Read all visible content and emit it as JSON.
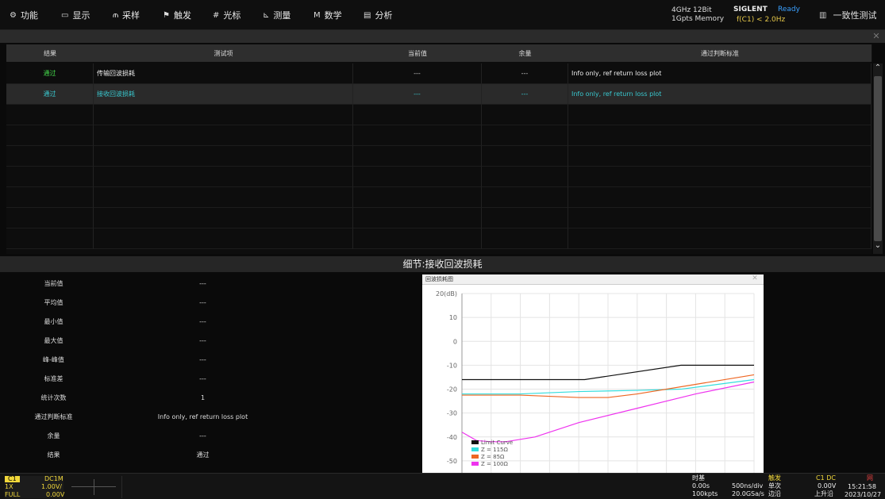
{
  "menu": {
    "items": [
      {
        "icon": "⚙",
        "label": "功能"
      },
      {
        "icon": "▭",
        "label": "显示"
      },
      {
        "icon": "⫙",
        "label": "采样"
      },
      {
        "icon": "⚑",
        "label": "触发"
      },
      {
        "icon": "#",
        "label": "光标"
      },
      {
        "icon": "⊾",
        "label": "测量"
      },
      {
        "icon": "M",
        "label": "数学"
      },
      {
        "icon": "▤",
        "label": "分析"
      }
    ],
    "spec_line1": "4GHz 12Bit",
    "spec_line2": "1Gpts Memory",
    "brand": "SIGLENT",
    "run_status": "Ready",
    "freq": "f(C1) < 2.0Hz",
    "conformance_icon": "▥",
    "conformance": "一致性测试"
  },
  "table": {
    "headers": [
      "结果",
      "测试项",
      "当前值",
      "余量",
      "通过判断标准"
    ],
    "rows": [
      {
        "result": "通过",
        "item": "传输回波损耗",
        "current": "---",
        "margin": "---",
        "criteria": "Info only, ref return loss plot"
      },
      {
        "result": "通过",
        "item": "接收回波损耗",
        "current": "---",
        "margin": "---",
        "criteria": "Info only, ref return loss plot"
      }
    ],
    "empty_rows": 7
  },
  "detail": {
    "title": "细节:接收回波损耗",
    "rows": [
      {
        "label": "当前值",
        "value": "---"
      },
      {
        "label": "平均值",
        "value": "---"
      },
      {
        "label": "最小值",
        "value": "---"
      },
      {
        "label": "最大值",
        "value": "---"
      },
      {
        "label": "峰-峰值",
        "value": "---"
      },
      {
        "label": "标准差",
        "value": "---"
      },
      {
        "label": "统计次数",
        "value": "1"
      },
      {
        "label": "通过判断标准",
        "value": "Info only, ref return loss plot"
      },
      {
        "label": "余量",
        "value": "---"
      },
      {
        "label": "结果",
        "value": "通过"
      }
    ]
  },
  "plot": {
    "window_title": "回波损耗图",
    "close_glyph": "✕"
  },
  "chart_data": {
    "type": "line",
    "ylabel": "",
    "ytick_labels": [
      "20(dB)",
      "10",
      "0",
      "-10",
      "-20",
      "-30",
      "-40",
      "-50"
    ],
    "ylim": [
      -55,
      20
    ],
    "xlim": [
      0,
      10
    ],
    "grid": true,
    "legend_position": "bottom-left",
    "series": [
      {
        "name": "Limit Curve",
        "color": "#111111",
        "x": [
          0,
          4.2,
          7.5,
          10
        ],
        "y": [
          -16,
          -16,
          -10,
          -10
        ]
      },
      {
        "name": "Z = 115Ω",
        "color": "#33dddd",
        "x": [
          0,
          2,
          4,
          6,
          7.5,
          10
        ],
        "y": [
          -22,
          -22,
          -21,
          -20.5,
          -20,
          -16
        ]
      },
      {
        "name": "Z = 85Ω",
        "color": "#ee6622",
        "x": [
          0,
          2,
          4,
          5,
          6,
          8,
          10
        ],
        "y": [
          -22.5,
          -22.5,
          -23.5,
          -23.5,
          -22,
          -18,
          -14
        ]
      },
      {
        "name": "Z = 100Ω",
        "color": "#ee33ee",
        "x": [
          0,
          0.5,
          1,
          1.5,
          2.5,
          4,
          6,
          8,
          10
        ],
        "y": [
          -38,
          -41.5,
          -42,
          -42,
          -40,
          -34,
          -28,
          -22,
          -17
        ]
      }
    ]
  },
  "bottom": {
    "ch_label": "C1",
    "ch_coupling": "DC1M",
    "ch_probe": "1X",
    "ch_scale": "1.00V/",
    "ch_bw": "FULL",
    "ch_offset": "0.00V",
    "timebase_title": "时基",
    "tb_delay": "0.00s",
    "tb_scale": "500ns/div",
    "tb_points": "100kpts",
    "tb_rate": "20.0GSa/s",
    "trig_title": "触发",
    "trig_mode": "单次",
    "trig_type": "边沿",
    "trig_src": "C1 DC",
    "trig_level": "0.00V",
    "trig_slope": "上升沿",
    "time": "15:21:58",
    "date": "2023/10/27",
    "net_icon": "网"
  }
}
